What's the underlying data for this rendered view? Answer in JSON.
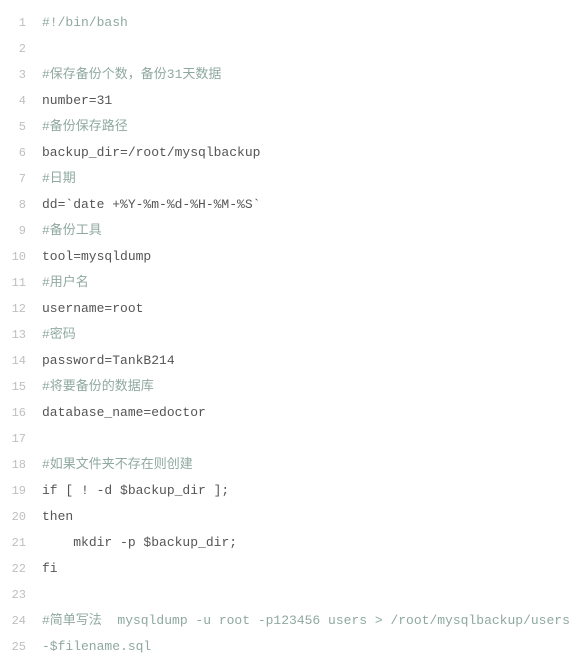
{
  "lines": [
    {
      "num": "1",
      "segments": [
        {
          "text": "#!/bin/bash",
          "cls": "comment"
        }
      ]
    },
    {
      "num": "2",
      "segments": [
        {
          "text": "",
          "cls": ""
        }
      ]
    },
    {
      "num": "3",
      "segments": [
        {
          "text": "#保存备份个数，备份31天数据",
          "cls": "comment"
        }
      ]
    },
    {
      "num": "4",
      "segments": [
        {
          "text": "number=31",
          "cls": ""
        }
      ]
    },
    {
      "num": "5",
      "segments": [
        {
          "text": "#备份保存路径",
          "cls": "comment"
        }
      ]
    },
    {
      "num": "6",
      "segments": [
        {
          "text": "backup_dir=/root/mysqlbackup",
          "cls": ""
        }
      ]
    },
    {
      "num": "7",
      "segments": [
        {
          "text": "#日期",
          "cls": "comment"
        }
      ]
    },
    {
      "num": "8",
      "segments": [
        {
          "text": "dd=`date +%Y-%m-%d-%H-%M-%S`",
          "cls": ""
        }
      ]
    },
    {
      "num": "9",
      "segments": [
        {
          "text": "#备份工具",
          "cls": "comment"
        }
      ]
    },
    {
      "num": "10",
      "segments": [
        {
          "text": "tool=mysqldump",
          "cls": ""
        }
      ]
    },
    {
      "num": "11",
      "segments": [
        {
          "text": "#用户名",
          "cls": "comment"
        }
      ]
    },
    {
      "num": "12",
      "segments": [
        {
          "text": "username=root",
          "cls": ""
        }
      ]
    },
    {
      "num": "13",
      "segments": [
        {
          "text": "#密码",
          "cls": "comment"
        }
      ]
    },
    {
      "num": "14",
      "segments": [
        {
          "text": "password=TankB214",
          "cls": ""
        }
      ]
    },
    {
      "num": "15",
      "segments": [
        {
          "text": "#将要备份的数据库",
          "cls": "comment"
        }
      ]
    },
    {
      "num": "16",
      "segments": [
        {
          "text": "database_name=edoctor",
          "cls": ""
        }
      ]
    },
    {
      "num": "17",
      "segments": [
        {
          "text": "",
          "cls": ""
        }
      ]
    },
    {
      "num": "18",
      "segments": [
        {
          "text": "#如果文件夹不存在则创建",
          "cls": "comment"
        }
      ]
    },
    {
      "num": "19",
      "segments": [
        {
          "text": "if [ ! -d $backup_dir ];",
          "cls": ""
        }
      ]
    },
    {
      "num": "20",
      "segments": [
        {
          "text": "then",
          "cls": ""
        }
      ]
    },
    {
      "num": "21",
      "segments": [
        {
          "text": "    mkdir -p $backup_dir;",
          "cls": ""
        }
      ]
    },
    {
      "num": "22",
      "segments": [
        {
          "text": "fi",
          "cls": ""
        }
      ]
    },
    {
      "num": "23",
      "segments": [
        {
          "text": "",
          "cls": ""
        }
      ]
    },
    {
      "num": "24",
      "segments": [
        {
          "text": "#简单写法  mysqldump -u root -p123456 users > /root/mysqlbackup/users-$filename.sql",
          "cls": "comment"
        }
      ]
    }
  ],
  "continuation_gutter": "25"
}
